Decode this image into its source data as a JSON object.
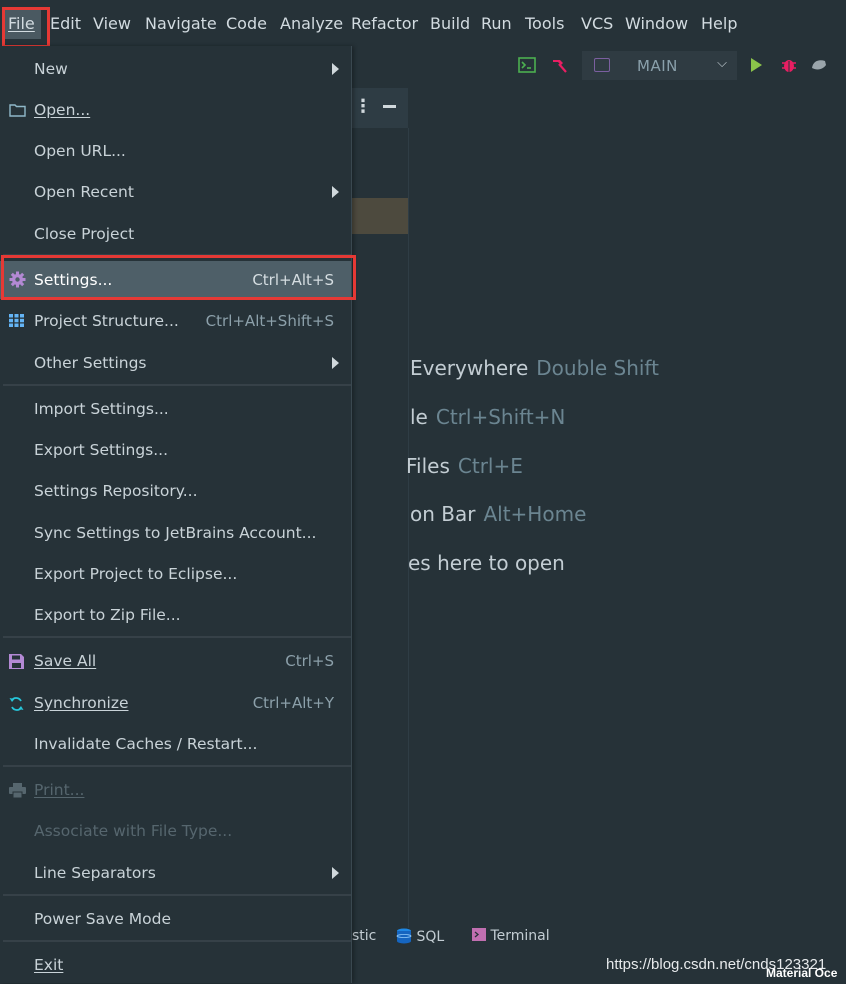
{
  "menubar": {
    "items": [
      {
        "label": "File",
        "active": true
      },
      {
        "label": "Edit"
      },
      {
        "label": "View"
      },
      {
        "label": "Navigate"
      },
      {
        "label": "Code"
      },
      {
        "label": "Analyze"
      },
      {
        "label": "Refactor"
      },
      {
        "label": "Build"
      },
      {
        "label": "Run"
      },
      {
        "label": "Tools"
      },
      {
        "label": "VCS"
      },
      {
        "label": "Window"
      },
      {
        "label": "Help"
      }
    ]
  },
  "toolbar": {
    "run_config": "MAIN",
    "icons": [
      "terminal-icon",
      "build-hammer-icon",
      "run-icon",
      "debug-icon",
      "coverage-icon"
    ]
  },
  "file_menu": {
    "items": [
      {
        "label": "New",
        "submenu": true
      },
      {
        "label": "Open...",
        "icon": "folder-icon"
      },
      {
        "label": "Open URL..."
      },
      {
        "label": "Open Recent",
        "submenu": true
      },
      {
        "label": "Close Project"
      },
      {
        "label": "Settings...",
        "shortcut": "Ctrl+Alt+S",
        "icon": "gear-icon",
        "selected": true
      },
      {
        "label": "Project Structure...",
        "shortcut": "Ctrl+Alt+Shift+S",
        "icon": "grid-icon"
      },
      {
        "label": "Other Settings",
        "submenu": true
      },
      {
        "label": "Import Settings..."
      },
      {
        "label": "Export Settings..."
      },
      {
        "label": "Settings Repository..."
      },
      {
        "label": "Sync Settings to JetBrains Account..."
      },
      {
        "label": "Export Project to Eclipse..."
      },
      {
        "label": "Export to Zip File..."
      },
      {
        "label": "Save All",
        "shortcut": "Ctrl+S",
        "icon": "save-icon"
      },
      {
        "label": "Synchronize",
        "shortcut": "Ctrl+Alt+Y",
        "icon": "sync-icon"
      },
      {
        "label": "Invalidate Caches / Restart..."
      },
      {
        "label": "Print...",
        "icon": "print-icon",
        "disabled": true
      },
      {
        "label": "Associate with File Type...",
        "disabled": true
      },
      {
        "label": "Line Separators",
        "submenu": true
      },
      {
        "label": "Power Save Mode"
      },
      {
        "label": "Exit"
      }
    ]
  },
  "editor_hints": [
    {
      "text": "Everywhere",
      "key": "Double Shift"
    },
    {
      "text": "le",
      "key": "Ctrl+Shift+N"
    },
    {
      "text": "Files",
      "key": "Ctrl+E"
    },
    {
      "text": "on Bar",
      "key": "Alt+Home"
    },
    {
      "text": "es here to open",
      "key": ""
    }
  ],
  "bottom_tabs": [
    {
      "label": "stic"
    },
    {
      "label": "SQL",
      "icon": "database-icon"
    },
    {
      "label": "Terminal",
      "icon": "terminal-tab-icon"
    }
  ],
  "watermark": "https://blog.csdn.net/cnds123321",
  "watermark_theme": "Material Oce",
  "colors": {
    "background": "#263238",
    "selected": "#4e5f68",
    "highlight_box": "#e53935",
    "run_green": "#8bc34a",
    "debug_pink": "#e91e63"
  }
}
